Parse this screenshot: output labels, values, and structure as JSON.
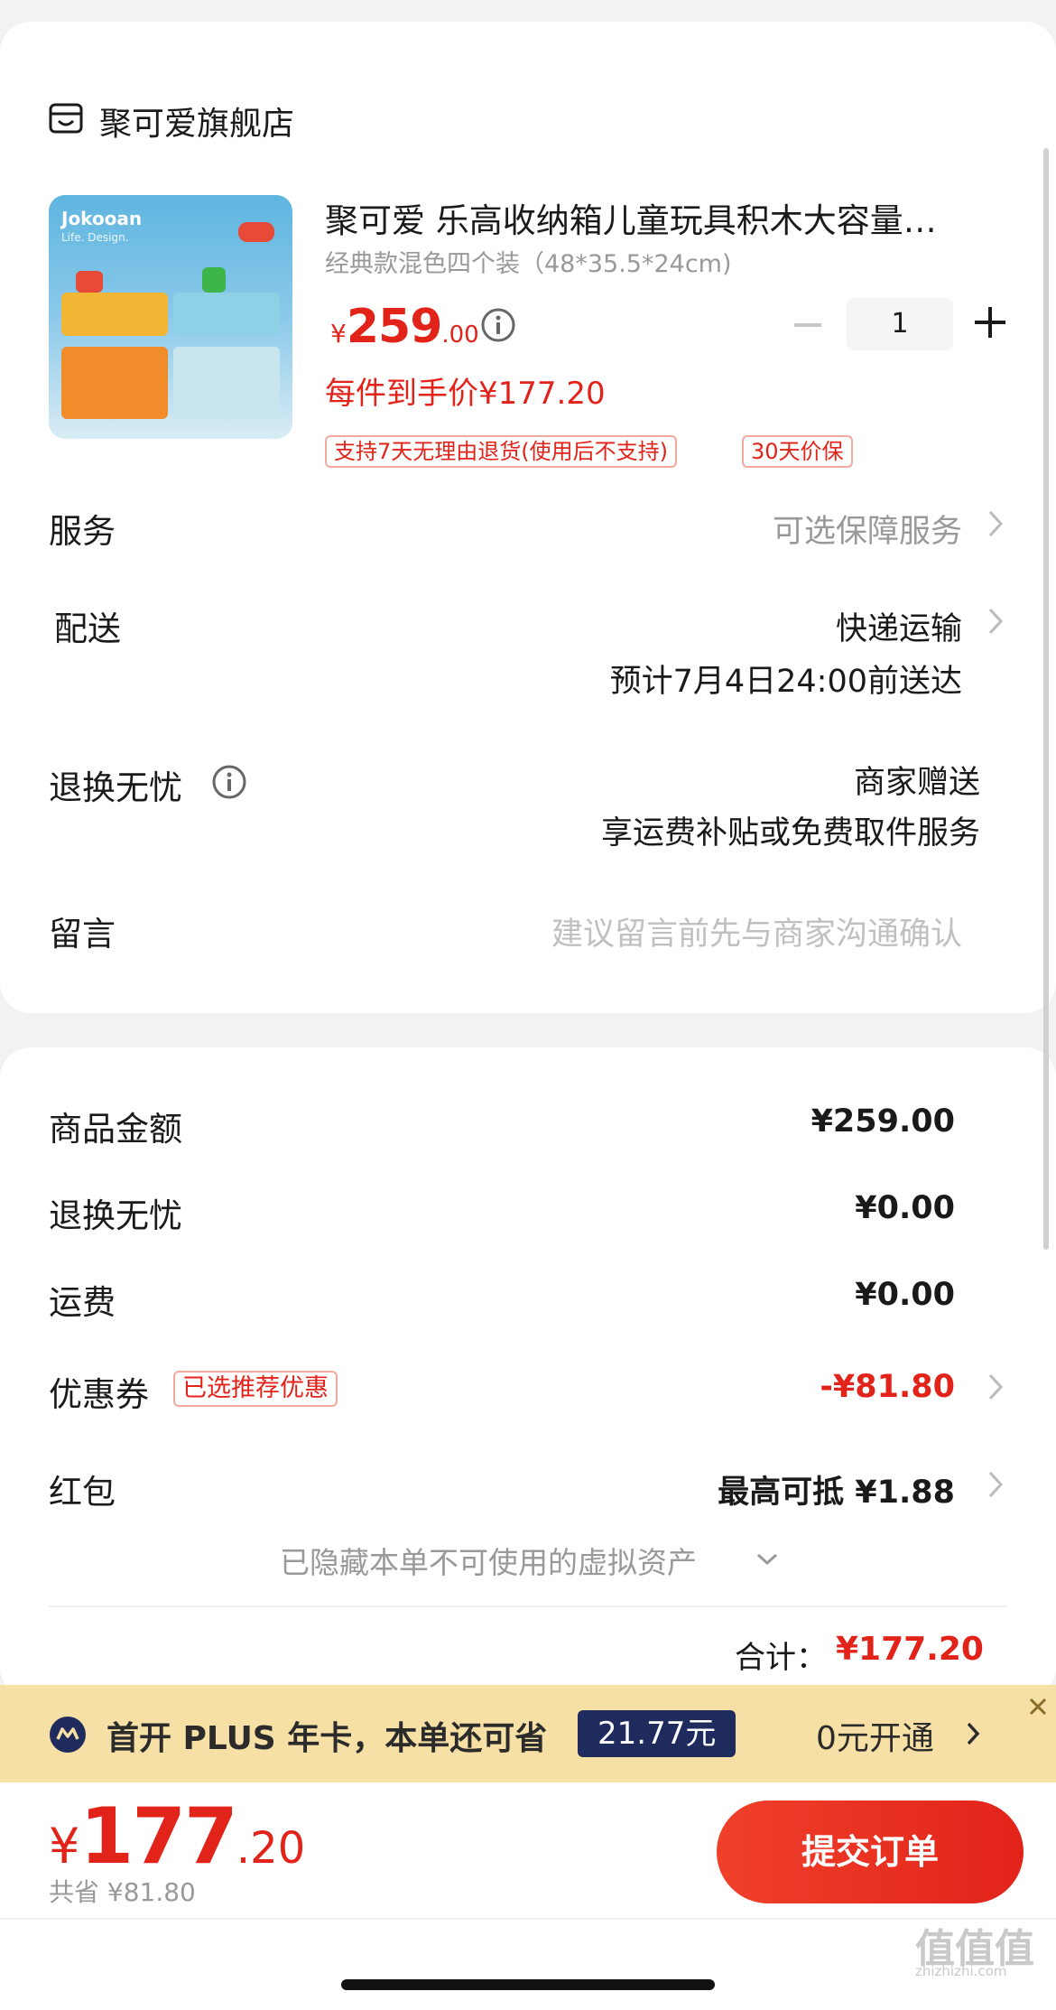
{
  "store": {
    "name": "聚可爱旗舰店",
    "icon": "shop-icon"
  },
  "product": {
    "title": "聚可爱 乐高收纳箱儿童玩具积木大容量…",
    "spec": "经典款混色四个装（48*35.5*24cm)",
    "price_symbol": "¥",
    "price_int": "259",
    "price_dec": ".00",
    "unit_price": "每件到手价¥177.20",
    "badges": [
      "支持7天无理由退货(使用后不支持)",
      "30天价保"
    ],
    "quantity": "1",
    "image_logo": "Jokooan",
    "image_tagline": "Life. Design."
  },
  "service": {
    "label": "服务",
    "value": "可选保障服务"
  },
  "delivery": {
    "label": "配送",
    "method": "快递运输",
    "eta": "预计7月4日24:00前送达"
  },
  "return": {
    "label": "退换无忧",
    "value1": "商家赠送",
    "value2": "享运费补贴或免费取件服务"
  },
  "message": {
    "label": "留言",
    "placeholder": "建议留言前先与商家沟通确认"
  },
  "summary": {
    "goods_label": "商品金额",
    "goods_value": "¥259.00",
    "return_label": "退换无忧",
    "return_value": "¥0.00",
    "shipping_label": "运费",
    "shipping_value": "¥0.00",
    "coupon_label": "优惠券",
    "coupon_tag": "已选推荐优惠",
    "coupon_value": "-¥81.80",
    "redpacket_label": "红包",
    "redpacket_value": "最高可抵 ¥1.88",
    "hidden_assets": "已隐藏本单不可使用的虚拟资产",
    "total_label": "合计：",
    "total_value": "¥177.20"
  },
  "plus": {
    "text": "首开 PLUS 年卡，本单还可省",
    "amount": "21.77元",
    "action": "0元开通"
  },
  "footer": {
    "price_symbol": "¥",
    "price_int": "177",
    "price_dec": ".20",
    "saving": "共省 ¥81.80",
    "submit": "提交订单",
    "watermark": "值值值",
    "watermark_sub": "zhizhizhi.com"
  },
  "colors": {
    "accent": "#e2231a",
    "plus_bg": "#f7e0a6",
    "plus_pill": "#1f2b5c"
  }
}
